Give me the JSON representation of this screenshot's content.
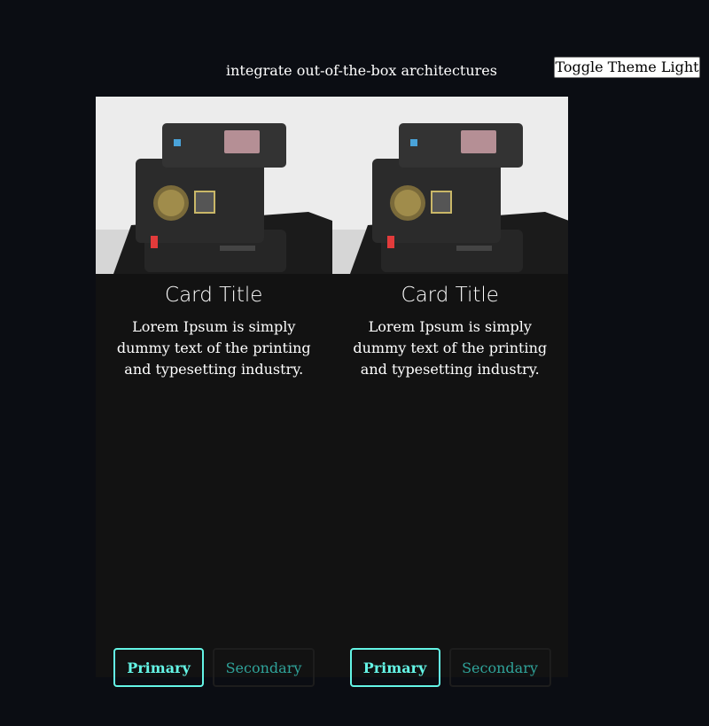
{
  "header": {
    "headline": "integrate out-of-the-box architectures",
    "toggle_label": "Toggle Theme Light"
  },
  "cards": [
    {
      "title": "Card Title",
      "text": "Lorem Ipsum is simply dummy text of the printing and typesetting industry.",
      "primary_label": "Primary",
      "secondary_label": "Secondary",
      "image_alt": "polaroid-camera-photo"
    },
    {
      "title": "Card Title",
      "text": "Lorem Ipsum is simply dummy text of the printing and typesetting industry.",
      "primary_label": "Primary",
      "secondary_label": "Secondary",
      "image_alt": "polaroid-camera-photo"
    }
  ],
  "colors": {
    "page_background": "#0b0d13",
    "card_background": "#121212",
    "primary_accent": "#64f5e6",
    "secondary_text": "#2fa39a"
  }
}
